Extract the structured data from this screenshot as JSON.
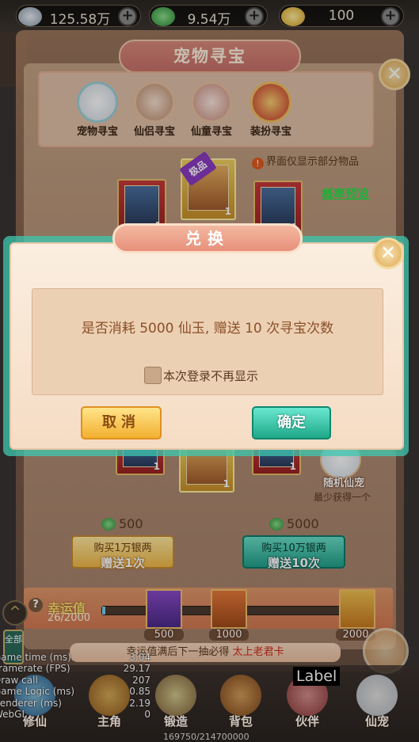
{
  "currency": {
    "silver": "125.58万",
    "jade": "9.54万",
    "gold": "100",
    "plus": "+"
  },
  "header": {
    "title": "宠物寻宝",
    "close_glyph": "✕"
  },
  "tabs": [
    "宠物寻宝",
    "仙侣寻宝",
    "仙童寻宝",
    "装扮寻宝"
  ],
  "notice": {
    "icon": "!",
    "text": "界面仅显示部分物品",
    "probability_link": "概率预览"
  },
  "cards": {
    "count": "1",
    "limit_tag": "极品"
  },
  "random_pet": {
    "label": "随机仙宠",
    "sub": "最少获得一个"
  },
  "buy": {
    "option1": {
      "price": "500",
      "line1": "购买1万银两",
      "line2": "赠送1次"
    },
    "option2": {
      "price": "5000",
      "line1": "购买10万银两",
      "line2": "赠送10次"
    }
  },
  "lucky": {
    "title": "幸运值",
    "value": "26/2000",
    "progress": 0.013,
    "help": "?",
    "milestones": [
      "500",
      "1000",
      "2000"
    ]
  },
  "tip": {
    "prefix": "幸运值满后下一抽必得",
    "reward": "太上老君卡"
  },
  "dialog": {
    "title": "兑换",
    "message": "是否消耗 5000 仙玉, 赠送 10 次寻宝次数",
    "checkbox_label": "本次登录不再显示",
    "cancel": "取消",
    "confirm": "确定",
    "close_glyph": "✕"
  },
  "bottom_nav": [
    "修仙",
    "主角",
    "锻造",
    "背包",
    "伙伴",
    "仙宠"
  ],
  "side": {
    "arrow": "^",
    "all": "全部"
  },
  "debug": [
    {
      "k": "Game time (ms)",
      "v": "3.04"
    },
    {
      "k": "Framerate (FPS)",
      "v": "29.17"
    },
    {
      "k": "Draw call",
      "v": "207"
    },
    {
      "k": "Game Logic (ms)",
      "v": "0.85"
    },
    {
      "k": "Renderer (ms)",
      "v": "2.19"
    },
    {
      "k": "WebGL",
      "v": "0"
    }
  ],
  "label_tag": "Label",
  "counter": "169750/214700000",
  "colors": {
    "accent_green": "#22a08a",
    "accent_yellow": "#f2b030",
    "link_green": "#2ae04a",
    "reward_red": "#d02a1a"
  }
}
